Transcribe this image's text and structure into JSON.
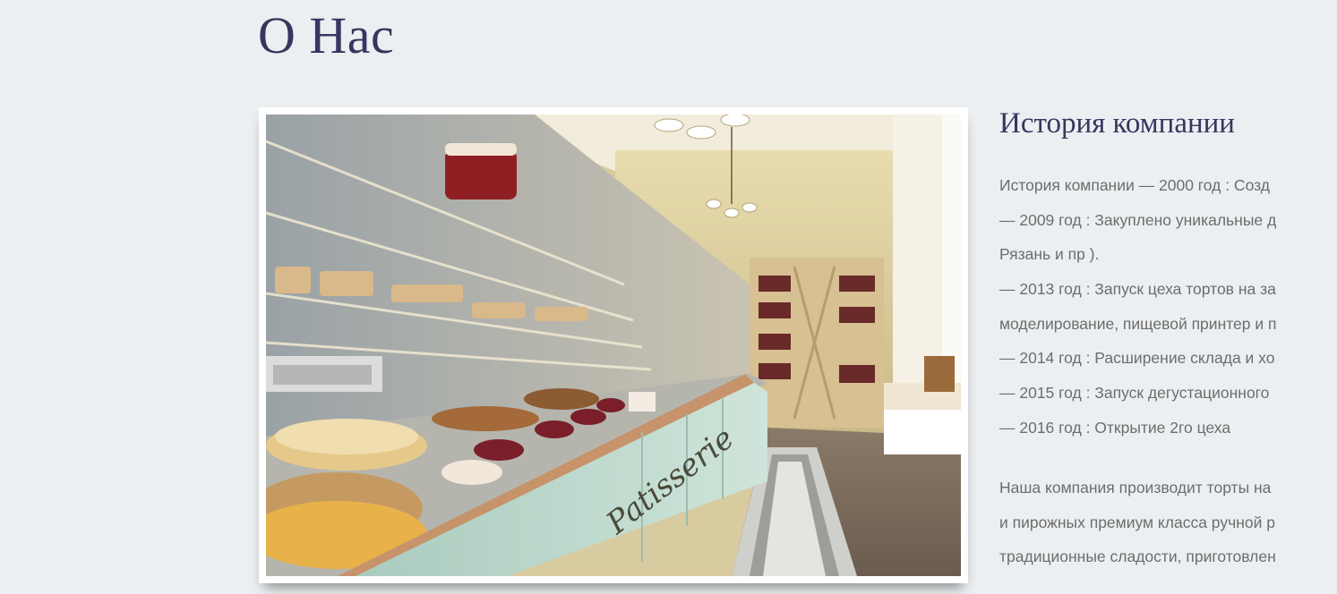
{
  "page": {
    "title": "О Нас"
  },
  "photo": {
    "alt": "Patisserie",
    "sign_text": "Patisserie"
  },
  "history": {
    "heading": "История компании",
    "lines": [
      "История компании — 2000 год : Созд",
      "— 2009 год : Закуплено уникальные д",
      "Рязань и пр ).",
      "— 2013 год : Запуск цеха тортов на за",
      "моделирование, пищевой принтер и п",
      "— 2014 год : Расширение склада и хо",
      "— 2015 год : Запуск дегустационного",
      "— 2016 год : Открытие 2го цеха"
    ]
  },
  "about": {
    "lines": [
      "Наша компания производит торты на",
      "и пирожных премиум класса ручной р",
      "традиционные сладости, приготовлен"
    ]
  },
  "colors": {
    "background": "#eceff1",
    "heading": "#3a3560",
    "body_text": "#6d6d6d"
  }
}
